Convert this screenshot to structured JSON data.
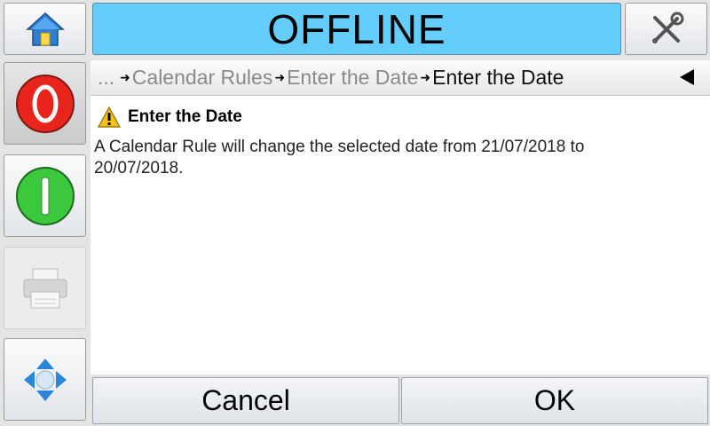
{
  "header": {
    "status_text": "OFFLINE"
  },
  "breadcrumb": {
    "ellipsis": "...",
    "items": [
      "Calendar Rules",
      "Enter the Date",
      "Enter the Date"
    ]
  },
  "message": {
    "title": "Enter the Date",
    "body": "A Calendar Rule will change the selected date from 21/07/2018 to 20/07/2018."
  },
  "buttons": {
    "cancel": "Cancel",
    "ok": "OK"
  },
  "icons": {
    "home": "home-icon",
    "tools": "tools-icon",
    "stop": "stop-icon",
    "start": "start-icon",
    "print": "printer-icon",
    "nav": "navigation-icon",
    "warning": "warning-icon",
    "back": "back-icon"
  },
  "colors": {
    "status_bar": "#63cdfb",
    "stop": "#e8241c",
    "start": "#3cc83c"
  }
}
